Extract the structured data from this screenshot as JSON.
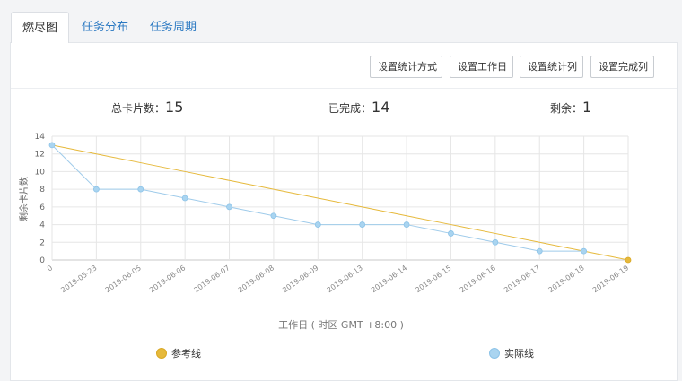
{
  "tabs": [
    {
      "label": "燃尽图",
      "active": true
    },
    {
      "label": "任务分布",
      "active": false
    },
    {
      "label": "任务周期",
      "active": false
    }
  ],
  "toolbar": {
    "buttons": [
      "设置统计方式",
      "设置工作日",
      "设置统计列",
      "设置完成列"
    ]
  },
  "stats": {
    "total_label": "总卡片数：",
    "total": "15",
    "done_label": "已完成：",
    "done": "14",
    "remaining_label": "剩余：",
    "remaining": "1"
  },
  "colors": {
    "reference": "#e6b93b",
    "actual": "#a9d4f0",
    "actual_line": "#9fcbea"
  },
  "chart_data": {
    "type": "line",
    "ylabel": "剩余卡片数",
    "xlabel": "工作日 ( 时区 GMT +8:00 )",
    "ylim": [
      0,
      14
    ],
    "yticks": [
      0,
      2,
      4,
      6,
      8,
      10,
      12,
      14
    ],
    "categories": [
      "0",
      "2019-05-23",
      "2019-06-05",
      "2019-06-06",
      "2019-06-07",
      "2019-06-08",
      "2019-06-09",
      "2019-06-13",
      "2019-06-14",
      "2019-06-15",
      "2019-06-16",
      "2019-06-17",
      "2019-06-18",
      "2019-06-19"
    ],
    "series": [
      {
        "name": "参考线",
        "values": [
          13,
          12,
          11,
          10,
          9,
          8,
          7,
          6,
          5,
          4,
          3,
          2,
          1,
          0
        ]
      },
      {
        "name": "实际线",
        "values": [
          13,
          8,
          8,
          7,
          6,
          5,
          4,
          4,
          4,
          3,
          2,
          1,
          1,
          null
        ]
      }
    ],
    "legend": "bottom"
  }
}
